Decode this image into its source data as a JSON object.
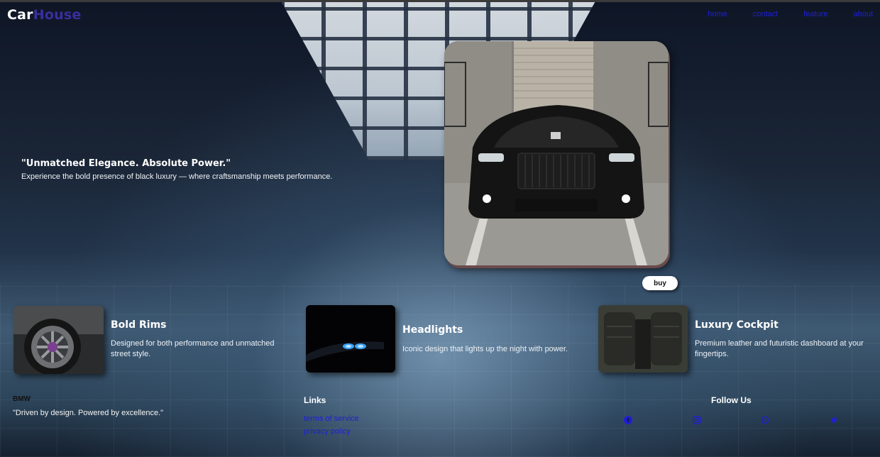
{
  "brand": {
    "part1": "Car",
    "part2": "House",
    "accent": "#3a2f9e"
  },
  "nav": {
    "links": [
      "home",
      "contact",
      "feature",
      "about"
    ],
    "color": "#1f1fd6"
  },
  "hero": {
    "title": "\"Unmatched Elegance. Absolute Power.\"",
    "subtitle": "Experience the bold presence of black luxury — where craftsmanship meets performance.",
    "buy_label": "buy"
  },
  "features": [
    {
      "title": "Bold Rims",
      "description": "Designed for both performance and unmatched street style."
    },
    {
      "title": "Headlights",
      "description": "Iconic design that lights up the night with power."
    },
    {
      "title": "Luxury Cockpit",
      "description": "Premium leather and futuristic dashboard at your fingertips."
    }
  ],
  "footer": {
    "brand": "BMW",
    "tagline": "\"Driven by design. Powered by excellence.\"",
    "links_title": "Links",
    "links": [
      "terms of service",
      "privacy policy"
    ],
    "follow_title": "Follow Us",
    "social_icons": [
      "facebook-icon",
      "instagram-icon",
      "whatsapp-icon",
      "twitter-icon"
    ]
  }
}
